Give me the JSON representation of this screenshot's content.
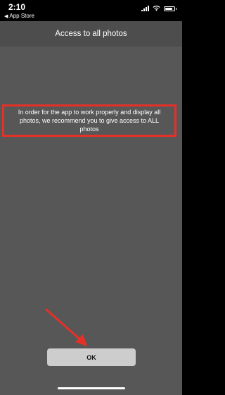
{
  "status_bar": {
    "time": "2:10",
    "back_app_label": "App Store",
    "wifi_icon": "wifi-icon",
    "battery_level": 0.85
  },
  "nav_bar": {
    "title": "Access to all photos"
  },
  "message": {
    "text": "In order for the app to work properly and display all photos, we recommend you to give access to ALL photos"
  },
  "action": {
    "ok_label": "OK"
  },
  "colors": {
    "background": "#575757",
    "nav_background": "#4d4d4d",
    "highlight": "#e53027",
    "button": "#cdcdcd"
  }
}
